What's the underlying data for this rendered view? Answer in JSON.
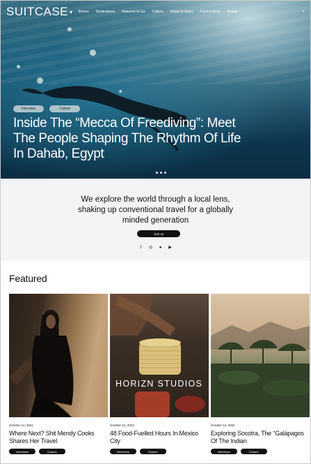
{
  "nav": {
    "logo": "SUITCASE",
    "links": [
      "Stories",
      "Destinations",
      "Reasons to Go",
      "Culture",
      "Hotels & Stays",
      "Food & Drink",
      "Events"
    ]
  },
  "hero": {
    "tags": [
      "Interview",
      "Culture"
    ],
    "title": "Inside The “Mecca Of Freediving”: Meet The People Shaping The Rhythm Of Life In Dahab, Egypt"
  },
  "tagline": {
    "text": "We explore the world through a local lens, shaking up conventional travel for a globally minded generation",
    "button": "Join us",
    "socials": [
      {
        "icon": "facebook-icon",
        "glyph": "f"
      },
      {
        "icon": "instagram-icon",
        "glyph": "◎"
      },
      {
        "icon": "pinterest-icon",
        "glyph": "●"
      },
      {
        "icon": "youtube-icon",
        "glyph": "▶"
      }
    ]
  },
  "featured": {
    "title": "Featured",
    "cards": [
      {
        "date": "October 14, 2024",
        "title": "Where Next? Shit Mendy Cooks Shares Her Travel",
        "tags": [
          "Interviews",
          "Explore"
        ]
      },
      {
        "date": "October 14, 2024",
        "title": "48 Food-Fuelled Hours In Mexico City",
        "tags": [
          "Interviews",
          "Explore"
        ],
        "watermark": "HORIZN STUDIOS"
      },
      {
        "date": "October 14, 2024",
        "title": "Exploring Socotra, The “Galápagos Of The Indian",
        "tags": [
          "Interviews",
          "Explore"
        ]
      }
    ]
  },
  "colors": {
    "accent": "#111111",
    "hero_water": "#1f5d78",
    "tagline_bg": "#f3f4f6"
  }
}
